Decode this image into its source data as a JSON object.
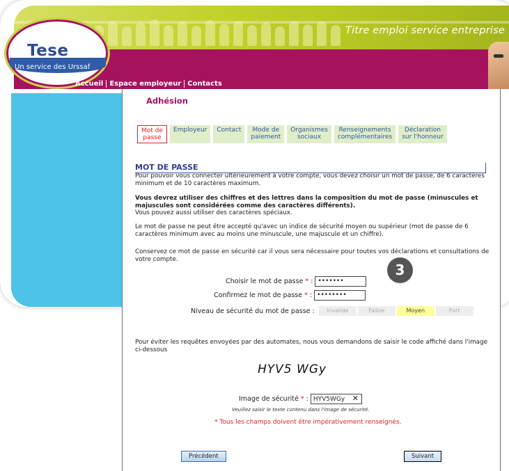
{
  "brand": {
    "logo_name": "Tese",
    "logo_subtitle": "Un service des Urssaf",
    "tagline": "Titre emploi service entreprise"
  },
  "topnav": {
    "items": [
      {
        "label": "Accueil"
      },
      {
        "label": "Espace employeur"
      },
      {
        "label": "Contacts"
      }
    ]
  },
  "page": {
    "title": "Adhésion"
  },
  "steps": [
    {
      "line1": "Mot de",
      "line2": "passe",
      "active": true
    },
    {
      "line1": "Employeur",
      "line2": ""
    },
    {
      "line1": "Contact",
      "line2": ""
    },
    {
      "line1": "Mode de",
      "line2": "paiement"
    },
    {
      "line1": "Organismes",
      "line2": "sociaux"
    },
    {
      "line1": "Renseignements",
      "line2": "complémentaires"
    },
    {
      "line1": "Déclaration",
      "line2": "sur l'honneur"
    }
  ],
  "section": {
    "heading": "MOT DE PASSE",
    "p1": "Pour pouvoir vous connecter ultérieurement à votre compte, vous devez choisir un mot de passe, de 6 caractères minimum et de 10 caractères maximum.",
    "p2_bold": "Vous devrez utiliser des chiffres et des lettres dans la composition du mot de passe (minuscules et majuscules sont considérées comme des caractères différents).",
    "p2_rest": "Vous pouvez aussi utiliser des caractères spéciaux.",
    "p3": "Le mot de passe ne peut être accepté qu'avec un indice de sécurité moyen ou supérieur (mot de passe de 6 caractères minimum avec au moins une minuscule, une majuscule et un chiffre).",
    "p4": "Conservez ce mot de passe en sécurité car il vous sera nécessaire pour toutes vos déclarations et consultations de votre compte."
  },
  "form": {
    "choose_label": "Choisir le mot de passe",
    "confirm_label": "Confirmez le mot de passe",
    "required_mark": "*",
    "colon": ":",
    "choose_value": "•••••••",
    "confirm_value": "••••••••",
    "security_label": "Niveau de sécurité du mot de passe :",
    "security_levels": [
      "Invalide",
      "Faible",
      "Moyen",
      "Fort"
    ],
    "security_current": "Moyen",
    "captcha_intro": "Pour éviter les requêtes envoyées par des automates, nous vous demandons de saisir le code affiché dans l'image ci-dessous",
    "captcha_image_text": "HYV5 WGy",
    "captcha_label": "Image de sécurité",
    "captcha_value": "HYV5WGy",
    "captcha_clear": "✕",
    "captcha_hint": "Veuillez saisir le texte contenu dans l'image de sécurité.",
    "all_required": "* Tous les champs doivent être impérativement renseignés."
  },
  "buttons": {
    "previous": "Précédent",
    "next": "Suivant"
  },
  "step_badge": "3",
  "colors": {
    "brand_magenta": "#a5135e",
    "banner_green": "#c3d12c",
    "sidebar_blue": "#4dc3e8",
    "heading_blue": "#2c3f8f",
    "required_red": "#dd2222"
  }
}
